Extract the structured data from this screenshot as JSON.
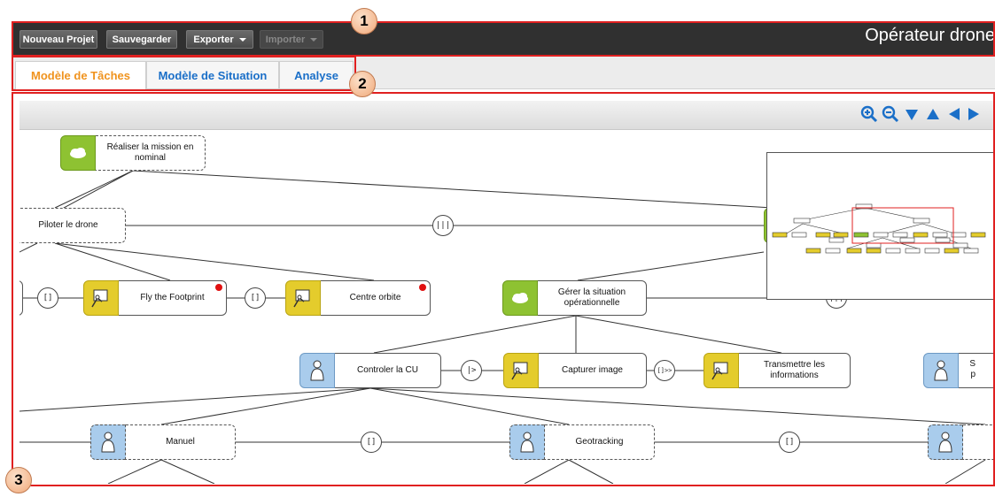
{
  "toolbar": {
    "new_project": "Nouveau Projet",
    "save": "Sauvegarder",
    "export": "Exporter",
    "import": "Importer",
    "title": "Opérateur drone"
  },
  "tabs": [
    {
      "label": "Modèle de Tâches",
      "active": true
    },
    {
      "label": "Modèle de Situation",
      "active": false
    },
    {
      "label": "Analyse",
      "active": false
    }
  ],
  "canvas_controls": [
    "zoom-in-icon",
    "zoom-out-icon",
    "arrow-down-icon",
    "arrow-up-icon",
    "arrow-left-icon",
    "arrow-right-icon"
  ],
  "tasks": {
    "root": "Réaliser la mission en nominal",
    "piloter": "Piloter le drone",
    "fly_footprint": "Fly the Footprint",
    "centre_orbite": "Centre orbite",
    "gerer": "Gérer la situation opérationnelle",
    "controler": "Controler la CU",
    "capturer": "Capturer image",
    "transmettre": "Transmettre les informations",
    "cut_s": "S",
    "cut_p": "p",
    "manuel": "Manuel",
    "geotracking": "Geotracking"
  },
  "operators": {
    "parallel": "|||",
    "choice": "[]",
    "interrupt": "|>",
    "sequence_info": "[]>>"
  },
  "annotations": [
    "1",
    "2",
    "3"
  ],
  "colors": {
    "abstract_task": "#8ec232",
    "interactive_task": "#e4cc2c",
    "user_task": "#a9ccec",
    "active_tab": "#f0931e",
    "tab_text": "#1a6fc8",
    "annotation_red": "#e02020"
  }
}
